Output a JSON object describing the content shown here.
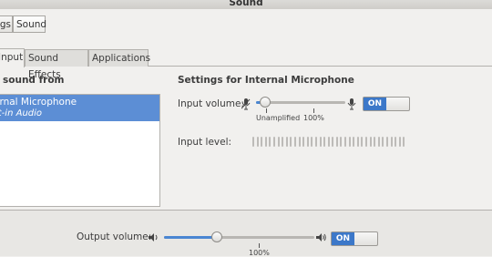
{
  "window": {
    "title": "Sound"
  },
  "breadcrumbs": [
    "gs",
    "Sound"
  ],
  "tabs": [
    "Input",
    "Sound Effects",
    "Applications"
  ],
  "left": {
    "heading": "sound from",
    "device": {
      "name": "ernal Microphone",
      "type": "lt-in Audio"
    }
  },
  "right": {
    "heading": "Settings for Internal Microphone",
    "input_volume_label": "Input volume:",
    "input_volume_level": 0.1,
    "unamplified_label": "Unamplified",
    "percent_label": "100%",
    "toggle_label": "ON",
    "input_level_label": "Input level:"
  },
  "output": {
    "label": "Output volume:",
    "level": 0.35,
    "percent_label": "100%",
    "toggle_label": "ON"
  },
  "colors": {
    "accent": "#4a86d2",
    "selection": "#5c8ed5",
    "toggle_on": "#3c78c9"
  }
}
